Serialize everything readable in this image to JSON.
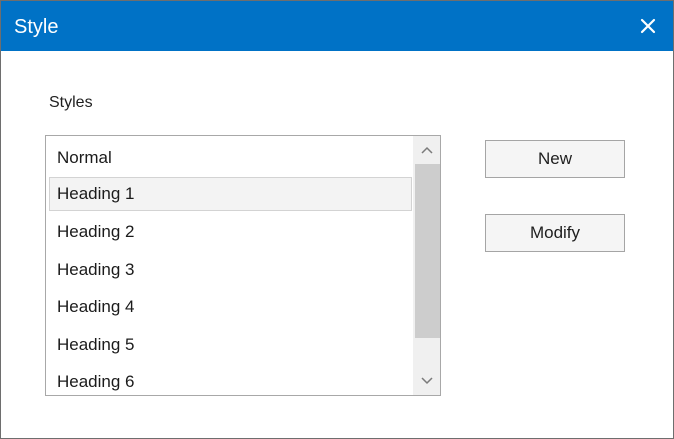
{
  "window": {
    "title": "Style",
    "close_icon": "close-icon"
  },
  "styles": {
    "label": "Styles",
    "items": [
      {
        "label": "Normal",
        "selected": false
      },
      {
        "label": "Heading 1",
        "selected": true
      },
      {
        "label": "Heading 2",
        "selected": false
      },
      {
        "label": "Heading 3",
        "selected": false
      },
      {
        "label": "Heading 4",
        "selected": false
      },
      {
        "label": "Heading 5",
        "selected": false
      },
      {
        "label": "Heading 6",
        "selected": false
      }
    ]
  },
  "buttons": {
    "new_label": "New",
    "modify_label": "Modify"
  },
  "colors": {
    "titlebar": "#0072c6",
    "selection": "#f3f3f3",
    "scroll_thumb": "#cdcdcd"
  }
}
